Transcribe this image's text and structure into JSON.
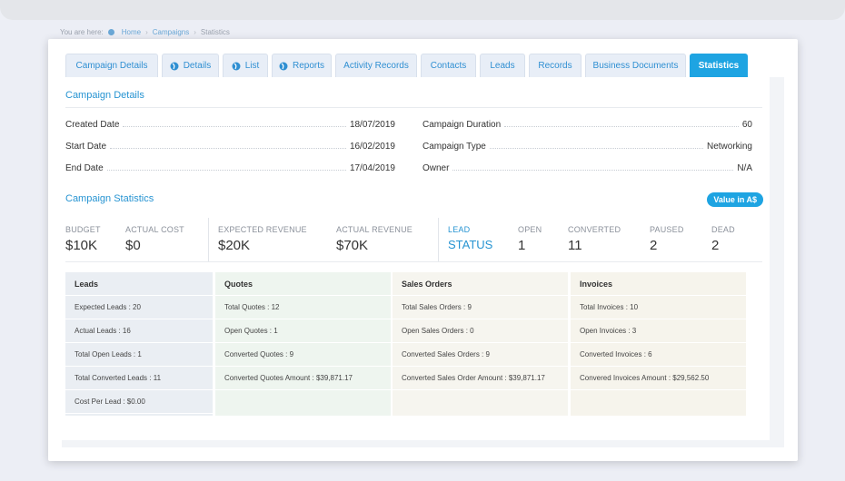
{
  "breadcrumb": {
    "prefix": "You are here:",
    "items": [
      "Home",
      "Campaigns",
      "Statistics"
    ]
  },
  "tabs": [
    {
      "label": "Campaign Details",
      "icon": "",
      "active": false
    },
    {
      "label": "Details",
      "icon": "globe-icon",
      "active": false
    },
    {
      "label": "List",
      "icon": "globe-icon",
      "active": false
    },
    {
      "label": "Reports",
      "icon": "globe-icon",
      "active": false
    },
    {
      "label": "Activity Records",
      "icon": "",
      "active": false
    },
    {
      "label": "Contacts",
      "icon": "",
      "active": false
    },
    {
      "label": "Leads",
      "icon": "",
      "active": false
    },
    {
      "label": "Records",
      "icon": "",
      "active": false
    },
    {
      "label": "Business Documents",
      "icon": "",
      "active": false
    },
    {
      "label": "Statistics",
      "icon": "",
      "active": true
    }
  ],
  "campaign_details": {
    "title": "Campaign Details",
    "left": [
      {
        "key": "Created Date",
        "value": "18/07/2019"
      },
      {
        "key": "Start Date",
        "value": "16/02/2019"
      },
      {
        "key": "End Date",
        "value": "17/04/2019"
      }
    ],
    "right": [
      {
        "key": "Campaign Duration",
        "value": "60"
      },
      {
        "key": "Campaign Type",
        "value": "Networking"
      },
      {
        "key": "Owner",
        "value": "N/A"
      }
    ]
  },
  "campaign_statistics": {
    "title": "Campaign Statistics",
    "badge": "Value in A$",
    "budget": {
      "label": "BUDGET",
      "value": "$10K"
    },
    "actual_cost": {
      "label": "ACTUAL COST",
      "value": "$0"
    },
    "expected_revenue": {
      "label": "EXPECTED REVENUE",
      "value": "$20K"
    },
    "actual_revenue": {
      "label": "ACTUAL REVENUE",
      "value": "$70K"
    },
    "lead_status": {
      "label": "LEAD",
      "value": "STATUS"
    },
    "open": {
      "label": "OPEN",
      "value": "1"
    },
    "converted": {
      "label": "CONVERTED",
      "value": "11"
    },
    "paused": {
      "label": "PAUSED",
      "value": "2"
    },
    "dead": {
      "label": "DEAD",
      "value": "2"
    }
  },
  "summary": {
    "leads": {
      "header": "Leads",
      "rows": [
        "Expected Leads : 20",
        "Actual Leads : 16",
        "Total Open Leads : 1",
        "Total Converted Leads : 11",
        "Cost Per Lead : $0.00"
      ]
    },
    "quotes": {
      "header": "Quotes",
      "rows": [
        "Total Quotes : 12",
        "Open Quotes : 1",
        "Converted Quotes : 9",
        "Converted Quotes Amount : $39,871.17"
      ]
    },
    "sales_orders": {
      "header": "Sales Orders",
      "rows": [
        "Total Sales Orders : 9",
        "Open Sales Orders : 0",
        "Converted Sales Orders : 9",
        "Converted Sales Order Amount : $39,871.17"
      ]
    },
    "invoices": {
      "header": "Invoices",
      "rows": [
        "Total Invoices : 10",
        "Open Invoices : 3",
        "Converted Invoices : 6",
        "Convered Invoices Amount : $29,562.50"
      ]
    }
  },
  "colors": {
    "accent": "#1ea4e2",
    "link": "#2794d2"
  }
}
